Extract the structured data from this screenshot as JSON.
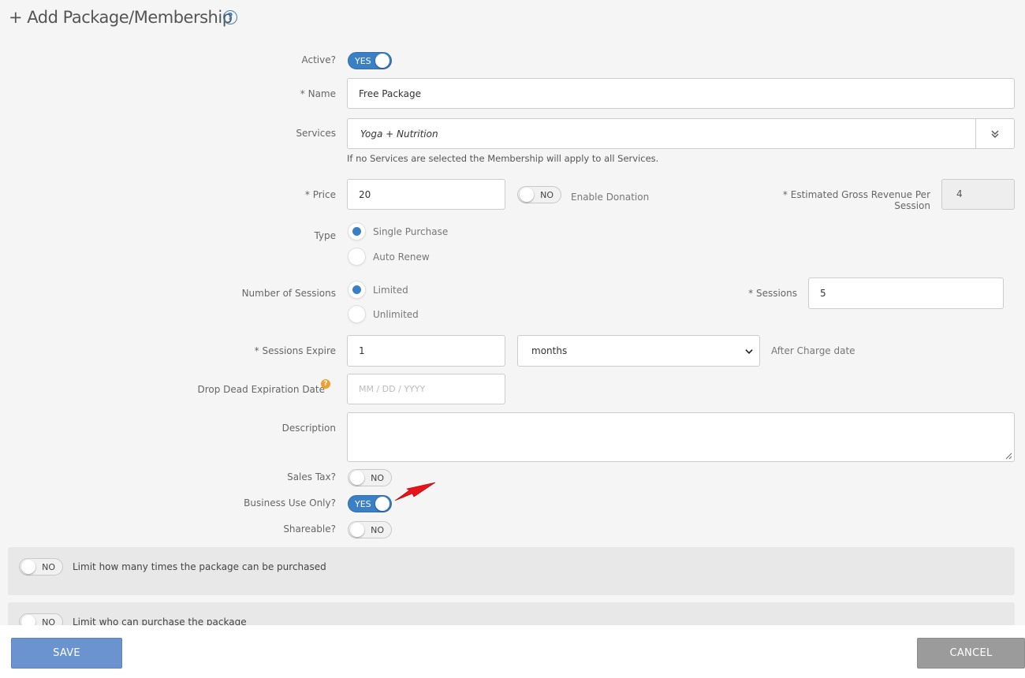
{
  "header": {
    "title": "+ Add Package/Membership",
    "help_icon": "?"
  },
  "form": {
    "active": {
      "label": "Active?",
      "state": "YES"
    },
    "name": {
      "label": "* Name",
      "value": "Free Package"
    },
    "services": {
      "label": "Services",
      "value": "Yoga + Nutrition",
      "hint": "If no Services are selected the Membership will apply to all Services."
    },
    "price": {
      "label": "* Price",
      "value": "20",
      "donation_state": "NO",
      "donation_label": "Enable Donation"
    },
    "estimated": {
      "label_line1": "* Estimated Gross Revenue Per",
      "label_line2": "Session",
      "value": "4"
    },
    "type": {
      "label": "Type",
      "options": [
        "Single Purchase",
        "Auto Renew"
      ],
      "selected": "Single Purchase"
    },
    "num_sessions": {
      "label": "Number of Sessions",
      "options": [
        "Limited",
        "Unlimited"
      ],
      "selected": "Limited",
      "sessions_label": "* Sessions",
      "sessions_value": "5"
    },
    "sessions_expire": {
      "label": "* Sessions Expire",
      "value": "1",
      "unit": "months",
      "suffix": "After Charge date"
    },
    "drop_dead": {
      "label": "Drop Dead Expiration Date",
      "placeholder": "MM / DD / YYYY",
      "help": "?"
    },
    "description": {
      "label": "Description",
      "value": ""
    },
    "sales_tax": {
      "label": "Sales Tax?",
      "state": "NO"
    },
    "business_use": {
      "label": "Business Use Only?",
      "state": "YES"
    },
    "shareable": {
      "label": "Shareable?",
      "state": "NO"
    }
  },
  "panels": {
    "limit_purchases": {
      "state": "NO",
      "label": "Limit how many times the package can be purchased"
    },
    "limit_who": {
      "state": "NO",
      "label": "Limit who can purchase the package"
    }
  },
  "footer": {
    "save_label": "SAVE",
    "cancel_label": "CANCEL"
  },
  "colors": {
    "accent": "#3b7fc4",
    "annotation_arrow": "#e8141c"
  }
}
